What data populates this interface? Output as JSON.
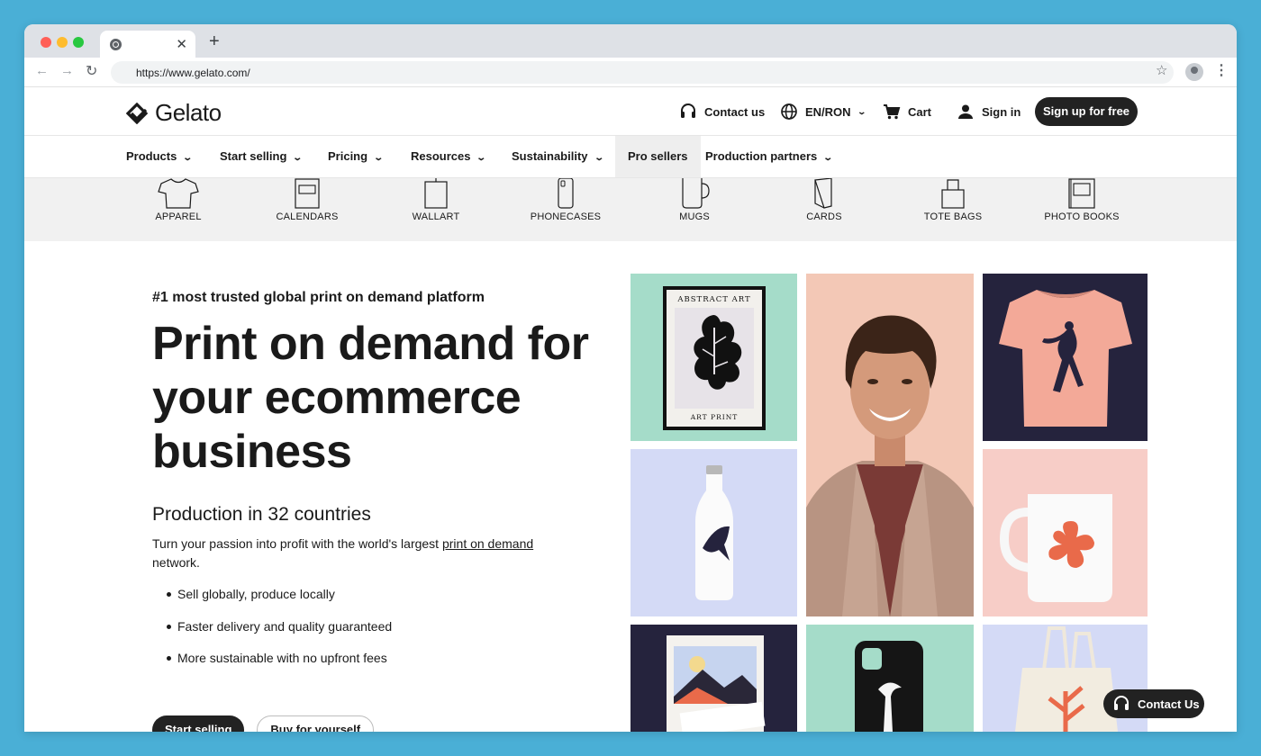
{
  "browser": {
    "tab_close": "✕",
    "new_tab": "+",
    "url": "https://www.gelato.com/"
  },
  "header": {
    "logo_text": "Gelato",
    "contact": "Contact us",
    "language": "EN/RON",
    "cart": "Cart",
    "sign_in": "Sign in",
    "sign_up": "Sign up for free"
  },
  "nav": {
    "products": "Products",
    "start_selling": "Start selling",
    "pricing": "Pricing",
    "resources": "Resources",
    "sustainability": "Sustainability",
    "pro_sellers": "Pro sellers",
    "production_partners": "Production partners"
  },
  "categories": [
    "APPAREL",
    "CALENDARS",
    "WALLART",
    "PHONECASES",
    "MUGS",
    "CARDS",
    "TOTE BAGS",
    "PHOTO BOOKS"
  ],
  "hero": {
    "tagline": "#1 most trusted global print on demand platform",
    "headline_1": "Print on demand for",
    "headline_2": "your ecommerce",
    "headline_3": "business",
    "subhead": "Production in 32 countries",
    "desc_before": "Turn your passion into profit with the world's largest ",
    "desc_link": "print on demand",
    "desc_after": "network.",
    "bullets": [
      "Sell globally, produce locally",
      "Faster delivery and quality guaranteed",
      "More sustainable with no upfront fees"
    ],
    "btn_primary": "Start selling",
    "btn_secondary": "Buy for yourself"
  },
  "gallery": {
    "poster_top": "ABSTRACT ART",
    "poster_bottom": "ART PRINT",
    "colors": {
      "mint": "#a5dcc9",
      "peach": "#f3c8b6",
      "navy": "#25233d",
      "lavender": "#d4daf6",
      "pink": "#f7cdc7"
    }
  },
  "float": {
    "contact": "Contact Us"
  }
}
